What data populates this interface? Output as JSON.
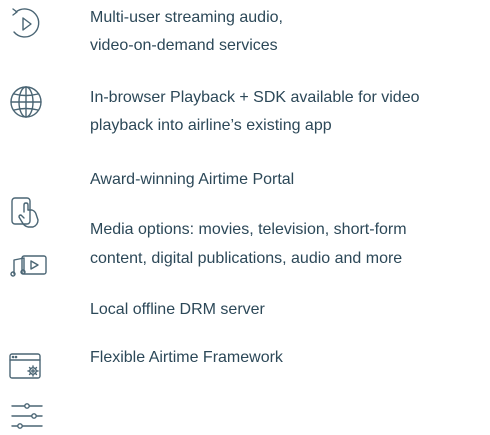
{
  "features": [
    {
      "icon": "play-cycle-icon",
      "line1": "Multi-user streaming audio,",
      "line2": "video-on-demand services"
    },
    {
      "icon": "globe-icon",
      "line1": "In-browser Playback + SDK available for video",
      "line2": "playback into airline’s existing app"
    },
    {
      "icon": null,
      "line1": "Award-winning Airtime Portal"
    },
    {
      "icon": "tablet-touch-icon",
      "icon2": "music-video-icon",
      "line1": "Media options: movies, television, short-form",
      "line2": "content, digital publications, audio and more"
    },
    {
      "icon": null,
      "line1": "Local offline DRM server"
    },
    {
      "icon": "browser-settings-icon",
      "icon2": "sliders-icon",
      "line1": "Flexible Airtime Framework"
    }
  ]
}
